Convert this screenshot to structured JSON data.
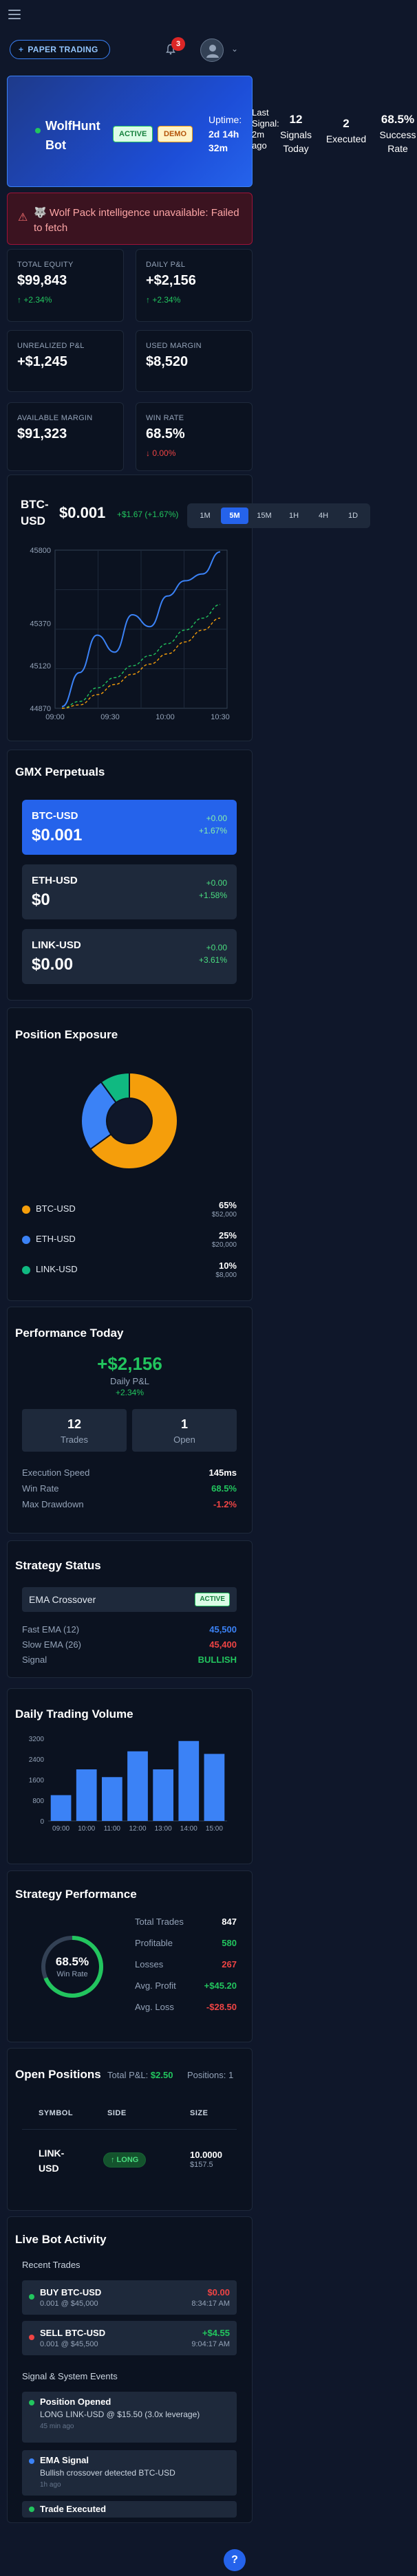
{
  "header": {
    "paper_trading_label": "PAPER TRADING",
    "notification_count": "3"
  },
  "bot": {
    "name": "WolfHunt Bot",
    "status": "ACTIVE",
    "mode": "DEMO",
    "uptime_label": "Uptime:",
    "uptime_value": "2d 14h 32m",
    "last_signal": "Last Signal: 2m ago",
    "signals_today": "12",
    "signals_today_label": "Signals Today",
    "executed": "2",
    "executed_label": "Executed",
    "success_rate": "68.5%",
    "success_rate_label": "Success Rate"
  },
  "alert": {
    "text": "🐺 Wolf Pack intelligence unavailable: Failed to fetch"
  },
  "metrics": [
    {
      "label": "TOTAL EQUITY",
      "value": "$99,843",
      "sub": "+2.34%"
    },
    {
      "label": "DAILY P&L",
      "value": "+$2,156",
      "sub": "+2.34%"
    },
    {
      "label": "UNREALIZED P&L",
      "value": "+$1,245",
      "sub": ""
    },
    {
      "label": "USED MARGIN",
      "value": "$8,520",
      "sub": ""
    },
    {
      "label": "AVAILABLE MARGIN",
      "value": "$91,323",
      "sub": ""
    },
    {
      "label": "WIN RATE",
      "value": "68.5%",
      "sub": "0.00%"
    }
  ],
  "price_chart": {
    "symbol": "BTC-USD",
    "price": "$0.001",
    "change": "+$1.67 (+1.67%)",
    "timeframes": [
      "1M",
      "5M",
      "15M",
      "1H",
      "4H",
      "1D"
    ],
    "selected": "5M",
    "y_ticks": [
      "45800",
      "45370",
      "45120",
      "44870"
    ],
    "x_ticks": [
      "09:00",
      "09:30",
      "10:00",
      "10:30"
    ]
  },
  "chart_data": {
    "type": "line",
    "x": [
      "09:00",
      "09:10",
      "09:20",
      "09:30",
      "09:40",
      "09:50",
      "10:00",
      "10:10",
      "10:20",
      "10:30"
    ],
    "series": [
      {
        "values": [
          44880,
          45080,
          45300,
          45200,
          45420,
          45350,
          45530,
          45620,
          45660,
          45790
        ],
        "color": "#3b82f6"
      },
      {
        "values": [
          44870,
          44910,
          44990,
          45050,
          45120,
          45180,
          45250,
          45330,
          45400,
          45480
        ],
        "color": "#22c55e"
      },
      {
        "values": [
          44870,
          44890,
          44950,
          45010,
          45070,
          45130,
          45190,
          45260,
          45330,
          45400
        ],
        "color": "#f59e0b"
      }
    ],
    "ylim": [
      44870,
      45800
    ]
  },
  "gmx": {
    "title": "GMX Perpetuals",
    "items": [
      {
        "pair": "BTC-USD",
        "price": "$0.001",
        "d1": "+0.00",
        "d2": "+1.67%"
      },
      {
        "pair": "ETH-USD",
        "price": "$0",
        "d1": "+0.00",
        "d2": "+1.58%"
      },
      {
        "pair": "LINK-USD",
        "price": "$0.00",
        "d1": "+0.00",
        "d2": "+3.61%"
      }
    ]
  },
  "exposure": {
    "title": "Position Exposure",
    "items": [
      {
        "name": "BTC-USD",
        "pct": "65%",
        "amount": "$52,000",
        "value": 65,
        "color": "#f59e0b"
      },
      {
        "name": "ETH-USD",
        "pct": "25%",
        "amount": "$20,000",
        "value": 25,
        "color": "#3b82f6"
      },
      {
        "name": "LINK-USD",
        "pct": "10%",
        "amount": "$8,000",
        "value": 10,
        "color": "#10b981"
      }
    ]
  },
  "performance": {
    "title": "Performance Today",
    "pnl": "+$2,156",
    "pnl_label": "Daily P&L",
    "pnl_pct": "+2.34%",
    "trades": "12",
    "trades_label": "Trades",
    "open": "1",
    "open_label": "Open",
    "rows": [
      {
        "k": "Execution Speed",
        "v": "145ms"
      },
      {
        "k": "Win Rate",
        "v": "68.5%"
      },
      {
        "k": "Max Drawdown",
        "v": "-1.2%"
      }
    ]
  },
  "strategy": {
    "title": "Strategy Status",
    "name": "EMA Crossover",
    "status": "ACTIVE",
    "rows": [
      {
        "k": "Fast EMA (12)",
        "v": "45,500"
      },
      {
        "k": "Slow EMA (26)",
        "v": "45,400"
      },
      {
        "k": "Signal",
        "v": "BULLISH"
      }
    ]
  },
  "volume": {
    "title": "Daily Trading Volume",
    "y_ticks": [
      "3200",
      "2400",
      "1600",
      "800",
      "0"
    ],
    "categories": [
      "09:00",
      "10:00",
      "11:00",
      "12:00",
      "13:00",
      "14:00",
      "15:00"
    ],
    "values": [
      1000,
      2000,
      1700,
      2700,
      2000,
      3100,
      2600
    ]
  },
  "strategy_perf": {
    "title": "Strategy Performance",
    "win_rate": "68.5%",
    "win_rate_value": 68.5,
    "win_rate_label": "Win Rate",
    "rows": [
      {
        "k": "Total Trades",
        "v": "847"
      },
      {
        "k": "Profitable",
        "v": "580"
      },
      {
        "k": "Losses",
        "v": "267"
      },
      {
        "k": "Avg. Profit",
        "v": "+$45.20"
      },
      {
        "k": "Avg. Loss",
        "v": "-$28.50"
      }
    ]
  },
  "positions": {
    "title": "Open Positions",
    "total_pnl_label": "Total P&L:",
    "total_pnl": "$2.50",
    "count": "Positions: 1",
    "headers": [
      "SYMBOL",
      "SIDE",
      "SIZE"
    ],
    "rows": [
      {
        "symbol": "LINK-USD",
        "side": "LONG",
        "size": "10.0000",
        "size_value": "$157.5"
      }
    ]
  },
  "activity": {
    "title": "Live Bot Activity",
    "recent_label": "Recent Trades",
    "trades": [
      {
        "title": "BUY BTC-USD",
        "detail": "0.001 @ $45,000",
        "pnl": "$0.00",
        "time": "8:34:17 AM"
      },
      {
        "title": "SELL BTC-USD",
        "detail": "0.001 @ $45,500",
        "pnl": "+$4.55",
        "time": "9:04:17 AM"
      }
    ],
    "events_label": "Signal & System Events",
    "events": [
      {
        "title": "Position Opened",
        "detail": "LONG LINK-USD @ $15.50 (3.0x leverage)",
        "time": "45 min ago"
      },
      {
        "title": "EMA Signal",
        "detail": "Bullish crossover detected BTC-USD",
        "time": "1h ago"
      },
      {
        "title": "Trade Executed",
        "detail": "",
        "time": ""
      }
    ]
  }
}
